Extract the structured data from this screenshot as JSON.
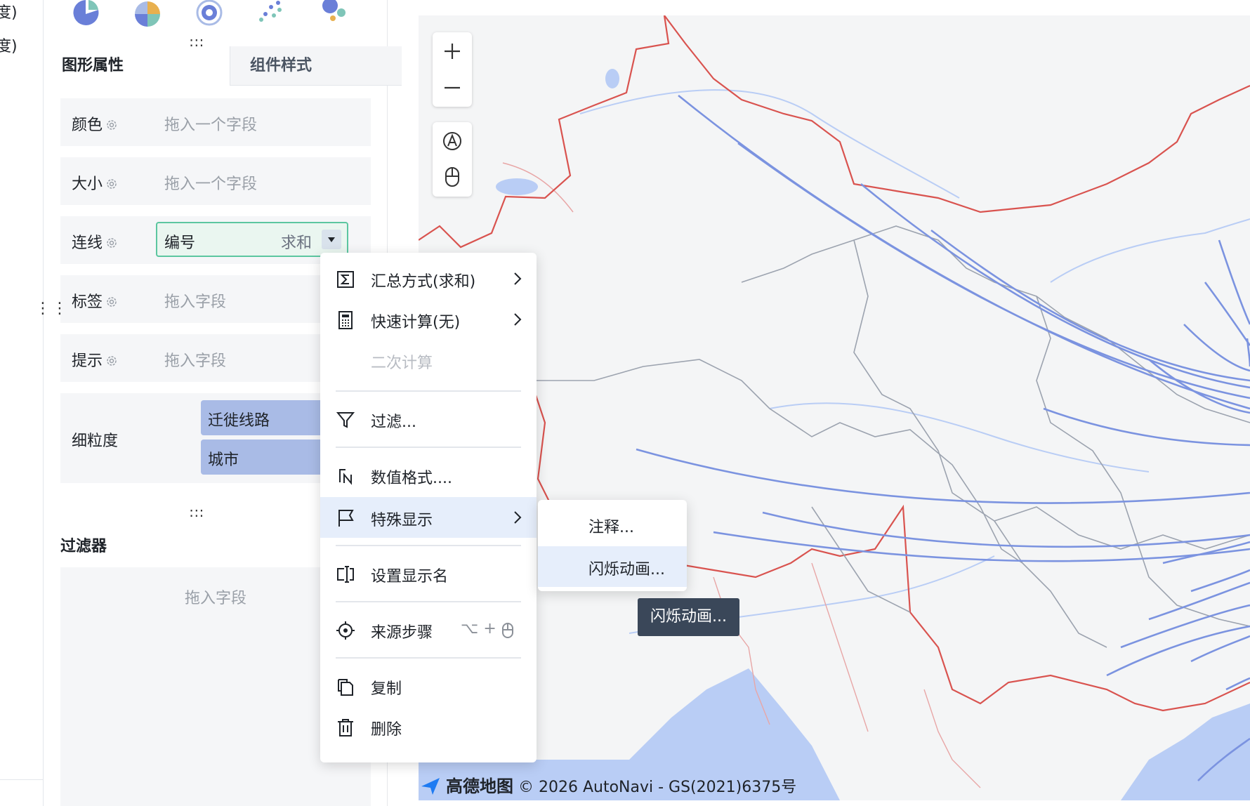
{
  "left_strip": {
    "line1": "度)",
    "line2": "度)"
  },
  "panel": {
    "tabs": {
      "active": "图形属性",
      "inactive": "组件样式"
    },
    "props": {
      "color": {
        "label": "颜色",
        "placeholder": "拖入一个字段"
      },
      "size": {
        "label": "大小",
        "placeholder": "拖入一个字段"
      },
      "line": {
        "label": "连线",
        "field": "编号",
        "agg": "求和"
      },
      "tag": {
        "label": "标签",
        "placeholder": "拖入字段"
      },
      "tip": {
        "label": "提示",
        "placeholder": "拖入字段"
      },
      "granularity": {
        "label": "细粒度",
        "fields": [
          "迁徙线路",
          "城市"
        ]
      }
    },
    "filter": {
      "title": "过滤器",
      "placeholder": "拖入字段"
    }
  },
  "menu": {
    "items": [
      {
        "label": "汇总方式(求和)",
        "icon": "sigma-icon",
        "arrow": true
      },
      {
        "label": "快速计算(无)",
        "icon": "calculator-icon",
        "arrow": true
      },
      {
        "label": "二次计算",
        "disabled": true
      },
      {
        "label": "过滤...",
        "icon": "filter-icon"
      },
      {
        "label": "数值格式....",
        "icon": "number-format-icon"
      },
      {
        "label": "特殊显示",
        "icon": "flag-icon",
        "arrow": true,
        "highlighted": true
      },
      {
        "label": "设置显示名",
        "icon": "rename-icon"
      },
      {
        "label": "来源步骤",
        "icon": "target-icon",
        "shortcut": "⌥ +"
      },
      {
        "label": "复制",
        "icon": "copy-icon"
      },
      {
        "label": "删除",
        "icon": "trash-icon"
      }
    ],
    "submenu": [
      {
        "label": "注释..."
      },
      {
        "label": "闪烁动画...",
        "highlighted": true
      }
    ],
    "tooltip": "闪烁动画..."
  },
  "map": {
    "attribution_logo": "高德地图",
    "attribution": "© 2026 AutoNavi - GS(2021)6375号",
    "line_color": "#7b93e0",
    "border_color": "#d9534f"
  }
}
